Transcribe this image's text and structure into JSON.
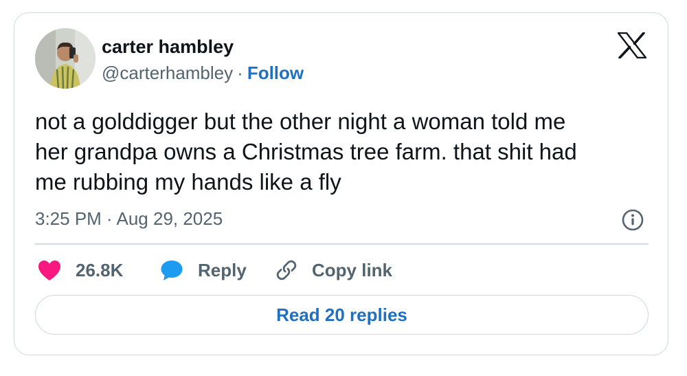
{
  "colors": {
    "text_primary": "#0f1419",
    "text_secondary": "#536471",
    "link_blue": "#1d70c2",
    "like_pink": "#f91880",
    "reply_blue": "#1d9bf0",
    "border": "#cfd9de"
  },
  "author": {
    "display_name": "carter hambley",
    "handle": "@carterhambley",
    "separator": "·",
    "follow_label": "Follow",
    "avatar_icon": "profile-photo"
  },
  "brand": {
    "logo_icon": "x-logo"
  },
  "tweet": {
    "text_lines": [
      "not a golddigger but the other night a woman told me",
      "her grandpa owns a Christmas tree farm. that shit had",
      "me rubbing my hands like a fly"
    ],
    "timestamp": "3:25 PM · Aug 29, 2025",
    "info_icon": "info-icon"
  },
  "actions": {
    "like": {
      "icon": "heart-icon",
      "count": "26.8K"
    },
    "reply": {
      "icon": "speech-bubble-icon",
      "label": "Reply"
    },
    "copy": {
      "icon": "link-icon",
      "label": "Copy link"
    }
  },
  "footer": {
    "read_replies_label": "Read 20 replies"
  }
}
